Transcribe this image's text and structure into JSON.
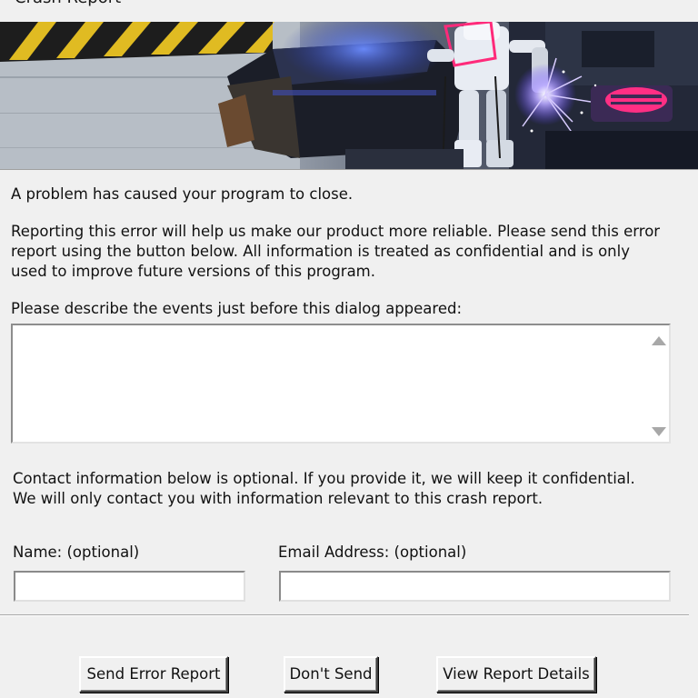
{
  "window": {
    "title": "Crash Report"
  },
  "banner": {
    "image": "sci-fi-robot-welding-illustration",
    "colors": {
      "hazard_yellow": "#e8c21a",
      "neon_blue": "#3a46ff",
      "neon_pink": "#ff2a7a",
      "sky": "#b9c0c8"
    }
  },
  "message": {
    "headline": "A problem has caused your program to close.",
    "body_line1": "Reporting this error will help us make our product more reliable.  Please send this error",
    "body_line2": "report using the button below.  All information is treated as confidential and is only",
    "body_line3": "used to improve future versions of this program."
  },
  "description": {
    "label": "Please describe the events just before this dialog appeared:",
    "value": "",
    "scroll_up_icon": "scroll-up-arrow-icon",
    "scroll_down_icon": "scroll-down-arrow-icon"
  },
  "contact": {
    "notice_line1": "Contact information below is optional. If you provide it, we will keep it confidential.",
    "notice_line2": "We will only contact you with  information relevant to this crash report.",
    "name_label": "Name: (optional)",
    "name_value": "",
    "email_label": "Email Address: (optional)",
    "email_value": ""
  },
  "buttons": {
    "send": "Send Error Report",
    "dont_send": "Don't Send",
    "view_details": "View Report Details"
  }
}
